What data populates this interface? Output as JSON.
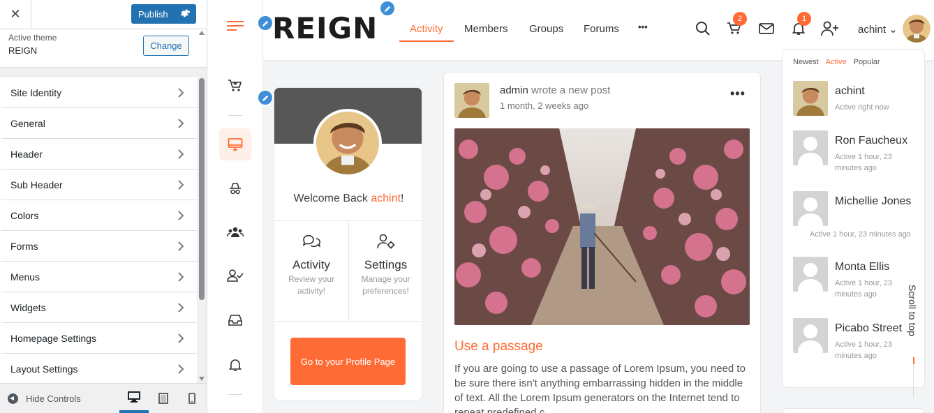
{
  "customizer": {
    "close_glyph": "✕",
    "publish_label": "Publish",
    "active_theme_label": "Active theme",
    "theme_name": "REIGN",
    "change_label": "Change",
    "sections": [
      {
        "label": "Site Identity"
      },
      {
        "label": "General"
      },
      {
        "label": "Header"
      },
      {
        "label": "Sub Header"
      },
      {
        "label": "Colors"
      },
      {
        "label": "Forms"
      },
      {
        "label": "Menus"
      },
      {
        "label": "Widgets"
      },
      {
        "label": "Homepage Settings"
      },
      {
        "label": "Layout Settings"
      }
    ],
    "hide_controls_label": "Hide Controls",
    "devices": [
      "desktop-icon",
      "tablet-icon",
      "mobile-icon"
    ]
  },
  "site": {
    "logo_text": "REIGN",
    "nav": [
      {
        "label": "Activity",
        "active": true
      },
      {
        "label": "Members"
      },
      {
        "label": "Groups"
      },
      {
        "label": "Forums"
      },
      {
        "label": "•••"
      }
    ],
    "cart_count": "2",
    "notification_count": "1",
    "user_name": "achint",
    "user_caret": "⌄",
    "accent_color": "#ff6b35",
    "sidebar_icons": [
      "cart-icon",
      "monitor-icon",
      "spy-icon",
      "group-icon",
      "user-check-icon",
      "inbox-icon",
      "bell-icon"
    ]
  },
  "profile_card": {
    "welcome_prefix": "Welcome Back ",
    "welcome_name": "achint",
    "welcome_suffix": "!",
    "activity_title": "Activity",
    "activity_sub": "Review your activity!",
    "settings_title": "Settings",
    "settings_sub": "Manage your preferences!",
    "profile_button": "Go to your Profile Page"
  },
  "feed": {
    "author": "admin",
    "action": " wrote a new post",
    "time": "1 month, 2 weeks ago",
    "menu_glyph": "•••",
    "post_title": "Use a passage",
    "post_text": "If you are going to use a passage of Lorem Ipsum, you need to be sure there isn't anything embarrassing hidden in the middle of text. All the Lorem Ipsum generators on the Internet tend to repeat predefined c"
  },
  "members": {
    "tabs": [
      {
        "label": "Newest"
      },
      {
        "label": "Active",
        "active": true
      },
      {
        "label": "Popular"
      }
    ],
    "list": [
      {
        "name": "achint",
        "status": "Active right now",
        "photo": true
      },
      {
        "name": "Ron Faucheux",
        "status": "Active 1 hour, 23 minutes ago"
      },
      {
        "name": "Michellie Jones",
        "status": "Active 1 hour, 23 minutes ago"
      },
      {
        "name": "Monta Ellis",
        "status": "Active 1 hour, 23 minutes ago"
      },
      {
        "name": "Picabo Street",
        "status": "Active 1 hour, 23 minutes ago"
      }
    ]
  },
  "scroll_to_top": "Scroll to top"
}
